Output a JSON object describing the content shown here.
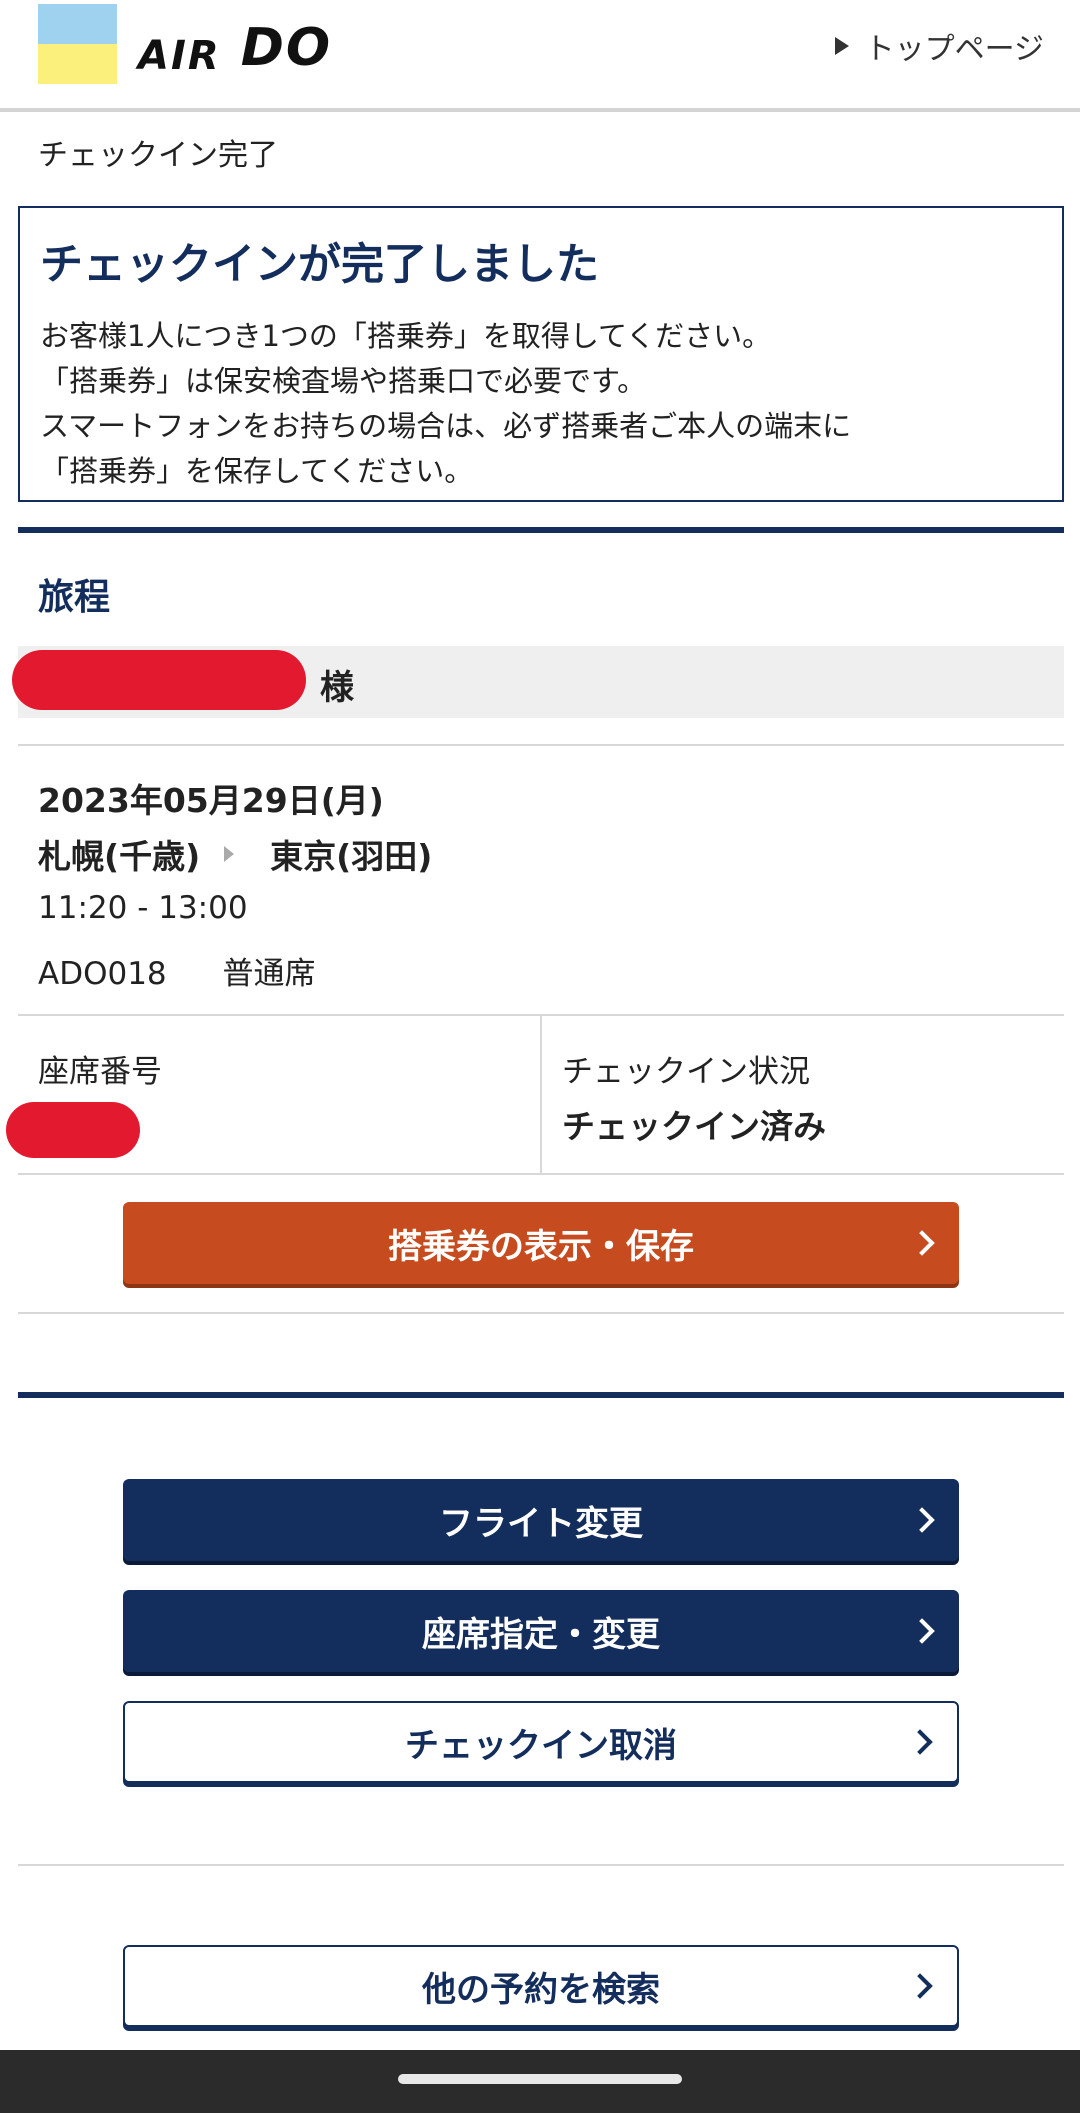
{
  "header": {
    "logo_text": "AIR DO",
    "logo_air": "AIR",
    "logo_do": "DO",
    "top_link": "トップページ"
  },
  "page_title": "チェックイン完了",
  "notice": {
    "heading": "チェックインが完了しました",
    "lines": [
      "お客様1人につき1つの「搭乗券」を取得してください。",
      "「搭乗券」は保安検査場や搭乗口で必要です。",
      "スマートフォンをお持ちの場合は、必ず搭乗者ご本人の端末に",
      "「搭乗券」を保存してください。"
    ]
  },
  "itinerary": {
    "title": "旅程",
    "name_suffix": "様",
    "date": "2023年05月29日(月)",
    "origin": "札幌(千歳)",
    "destination": "東京(羽田)",
    "times": "11:20 - 13:00",
    "flight_number": "ADO018",
    "seat_class": "普通席",
    "seat_label": "座席番号",
    "checkin_label": "チェックイン状況",
    "checkin_status": "チェックイン済み"
  },
  "buttons": {
    "boarding_pass": "搭乗券の表示・保存",
    "flight_change": "フライト変更",
    "seat_change": "座席指定・変更",
    "cancel_checkin": "チェックイン取消",
    "search_other": "他の予約を検索"
  },
  "colors": {
    "navy": "#132d5c",
    "orange": "#c64b1f",
    "redaction": "#e3192f",
    "logo_blue": "#9fd2ef",
    "logo_yellow": "#fbf07c"
  }
}
